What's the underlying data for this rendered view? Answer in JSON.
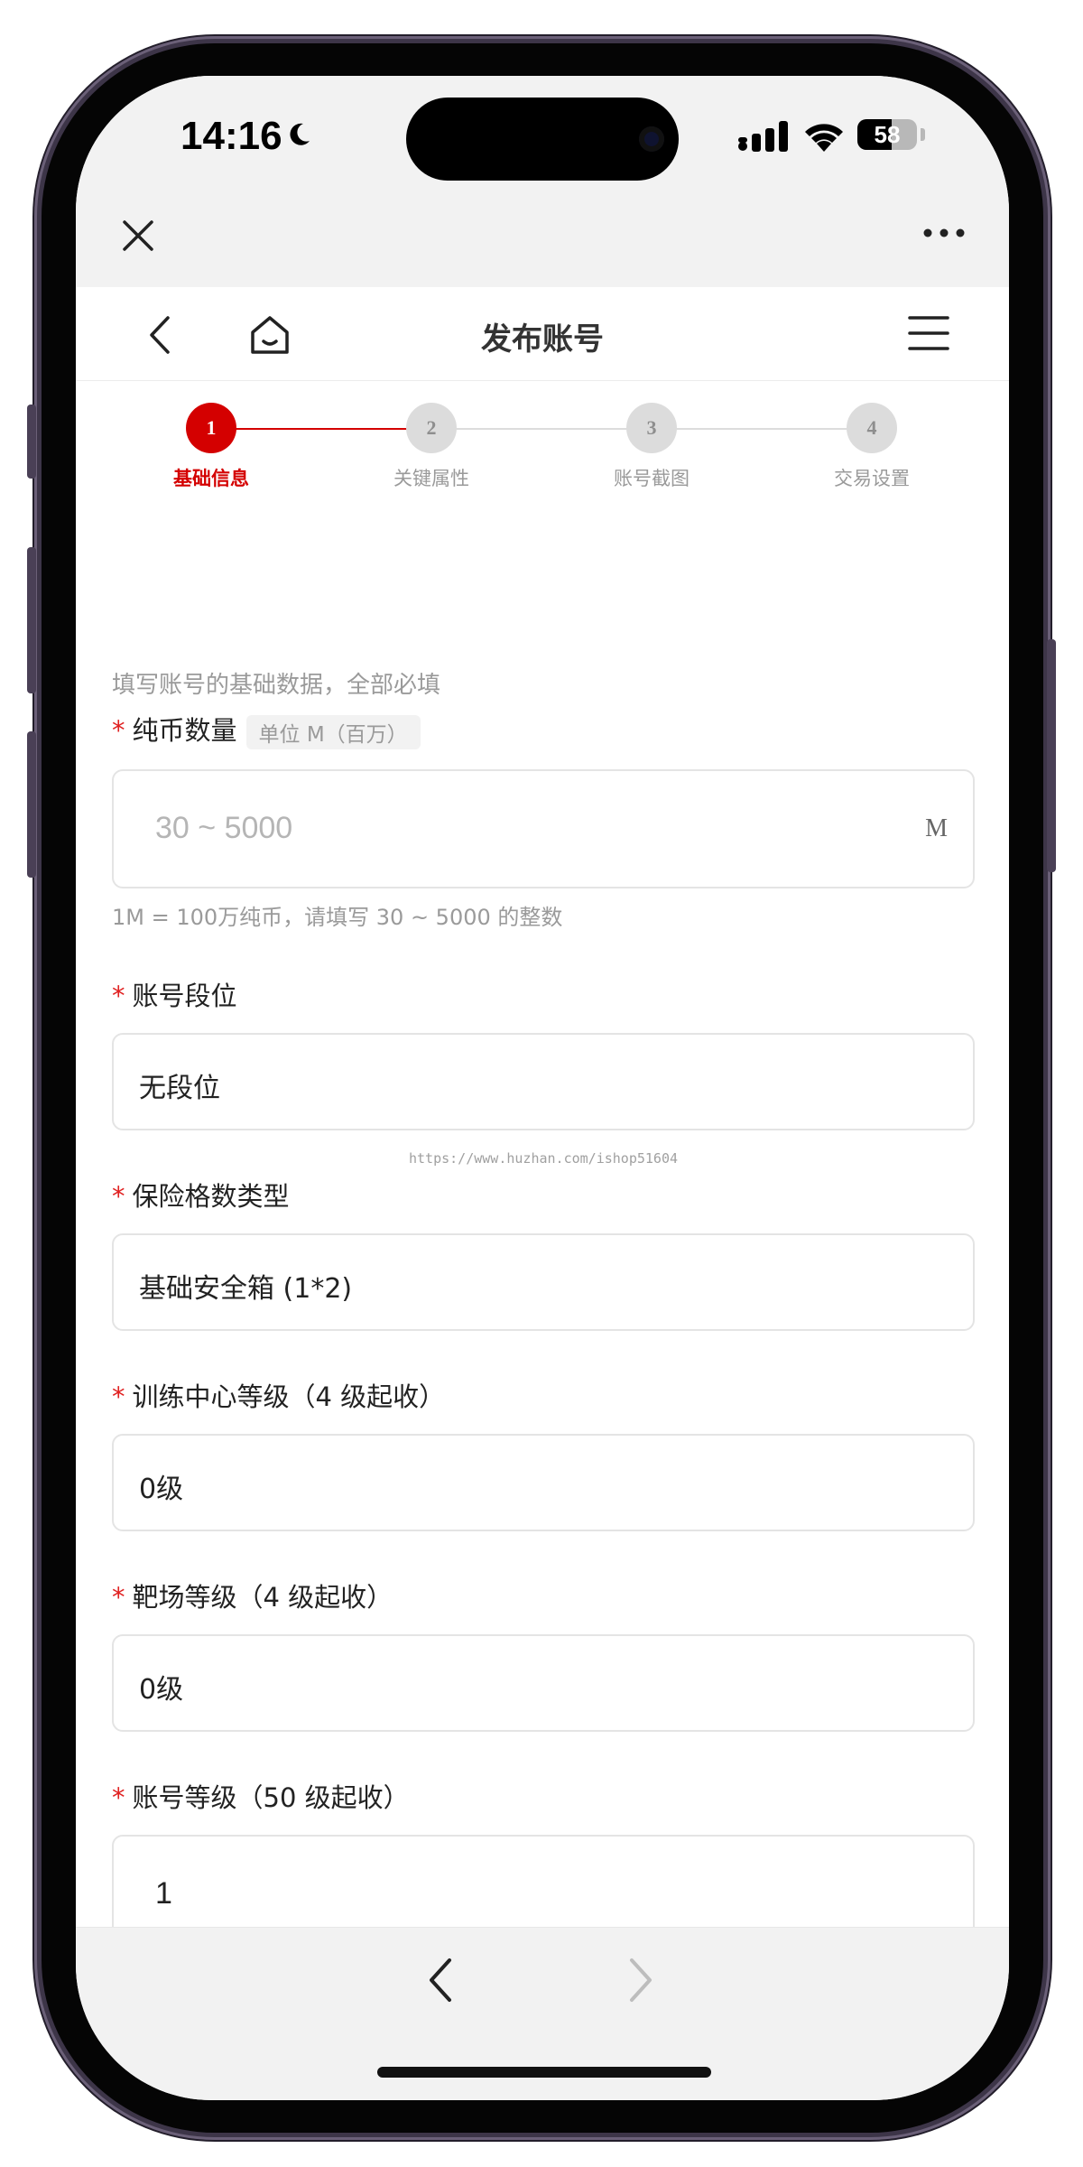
{
  "status_bar": {
    "time": "14:16",
    "battery_level": "58"
  },
  "nav": {
    "title": "发布账号"
  },
  "stepper": {
    "steps": [
      {
        "number": "1",
        "label": "基础信息"
      },
      {
        "number": "2",
        "label": "关键属性"
      },
      {
        "number": "3",
        "label": "账号截图"
      },
      {
        "number": "4",
        "label": "交易设置"
      }
    ],
    "active_index": 0
  },
  "form": {
    "hint": "填写账号的基础数据，全部必填",
    "required_mark": "*",
    "watermark": "https://www.huzhan.com/ishop51604",
    "coins": {
      "label": "纯币数量",
      "unit_badge": "单位 M（百万）",
      "placeholder": "30 ~ 5000",
      "suffix": "M",
      "sub_hint": "1M = 100万纯币，请填写 30 ~ 5000 的整数"
    },
    "rank": {
      "label": "账号段位",
      "value": "无段位"
    },
    "insurance": {
      "label": "保险格数类型",
      "value": "基础安全箱 (1*2)"
    },
    "training": {
      "label": "训练中心等级（4 级起收）",
      "value": "0级"
    },
    "range": {
      "label": "靶场等级（4 级起收）",
      "value": "0级"
    },
    "account_level": {
      "label": "账号等级（50 级起收）",
      "value": "1"
    }
  },
  "colors": {
    "accent": "#d40000",
    "inactive_step": "#dcdcdc",
    "muted_text": "#9a9a9a"
  }
}
